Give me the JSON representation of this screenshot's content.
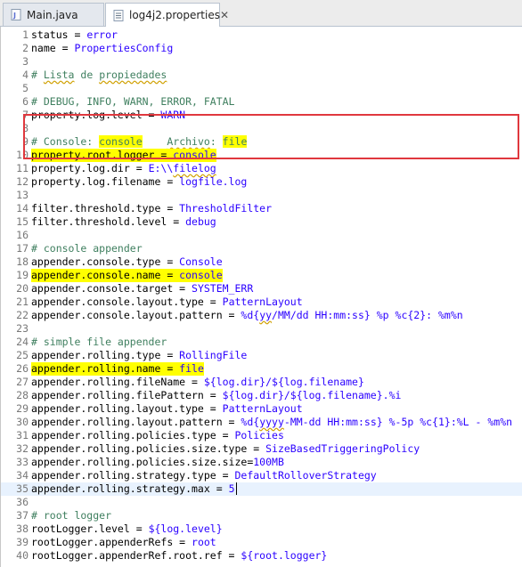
{
  "tabs": [
    {
      "label": "Main.java",
      "icon": "java-file-icon",
      "active": false
    },
    {
      "label": "log4j2.properties",
      "icon": "properties-file-icon",
      "active": true,
      "close": "✕"
    }
  ],
  "colors": {
    "key": "#000000",
    "value": "#2a00ff",
    "comment": "#3f7f5f",
    "highlight": "#ffff00",
    "current_line": "#e8f2fe",
    "annotation_box": "#e0383e"
  },
  "lines": [
    {
      "n": "1",
      "hl": false,
      "segs": [
        [
          "k",
          "status = "
        ],
        [
          "v",
          "error"
        ]
      ]
    },
    {
      "n": "2",
      "hl": false,
      "segs": [
        [
          "k",
          "name = "
        ],
        [
          "v",
          "PropertiesConfig"
        ]
      ]
    },
    {
      "n": "3",
      "hl": false,
      "segs": []
    },
    {
      "n": "4",
      "hl": false,
      "segs": [
        [
          "c",
          "# "
        ],
        [
          "cu",
          "Lista"
        ],
        [
          "c",
          " de "
        ],
        [
          "cu",
          "propiedades"
        ]
      ]
    },
    {
      "n": "5",
      "hl": false,
      "segs": []
    },
    {
      "n": "6",
      "hl": false,
      "segs": [
        [
          "c",
          "# DEBUG, INFO, WARN, ERROR, FATAL"
        ]
      ]
    },
    {
      "n": "7",
      "hl": false,
      "segs": [
        [
          "k",
          "property.log.level = "
        ],
        [
          "v",
          "WARN"
        ]
      ]
    },
    {
      "n": "8",
      "hl": false,
      "segs": []
    },
    {
      "n": "9",
      "hl": false,
      "segs": [
        [
          "c",
          "# Console: "
        ],
        [
          "ch",
          "console"
        ],
        [
          "c",
          "    "
        ],
        [
          "cu",
          "Archivo"
        ],
        [
          "c",
          ": "
        ],
        [
          "ch",
          "file"
        ]
      ]
    },
    {
      "n": "10",
      "hl": true,
      "segs": [
        [
          "k",
          "property.root.logger = "
        ],
        [
          "v",
          "console"
        ]
      ]
    },
    {
      "n": "11",
      "hl": false,
      "segs": [
        [
          "k",
          "property.log.dir = "
        ],
        [
          "v",
          "E:\\\\"
        ],
        [
          "vu",
          "filelog"
        ]
      ]
    },
    {
      "n": "12",
      "hl": false,
      "segs": [
        [
          "k",
          "property.log.filename = "
        ],
        [
          "v",
          "logfile.log"
        ]
      ]
    },
    {
      "n": "13",
      "hl": false,
      "segs": []
    },
    {
      "n": "14",
      "hl": false,
      "segs": [
        [
          "k",
          "filter.threshold.type = "
        ],
        [
          "v",
          "ThresholdFilter"
        ]
      ]
    },
    {
      "n": "15",
      "hl": false,
      "segs": [
        [
          "k",
          "filter.threshold.level = "
        ],
        [
          "v",
          "debug"
        ]
      ]
    },
    {
      "n": "16",
      "hl": false,
      "segs": []
    },
    {
      "n": "17",
      "hl": false,
      "segs": [
        [
          "c",
          "# console appender"
        ]
      ]
    },
    {
      "n": "18",
      "hl": false,
      "segs": [
        [
          "k",
          "appender.console.type = "
        ],
        [
          "v",
          "Console"
        ]
      ]
    },
    {
      "n": "19",
      "hl": true,
      "segs": [
        [
          "k",
          "appender.console.name = "
        ],
        [
          "v",
          "console"
        ]
      ]
    },
    {
      "n": "20",
      "hl": false,
      "segs": [
        [
          "k",
          "appender.console.target = "
        ],
        [
          "v",
          "SYSTEM_ERR"
        ]
      ]
    },
    {
      "n": "21",
      "hl": false,
      "segs": [
        [
          "k",
          "appender.console.layout.type = "
        ],
        [
          "v",
          "PatternLayout"
        ]
      ]
    },
    {
      "n": "22",
      "hl": false,
      "segs": [
        [
          "k",
          "appender.console.layout.pattern = "
        ],
        [
          "v",
          "%d{"
        ],
        [
          "vu",
          "yy"
        ],
        [
          "v",
          "/MM/dd HH:mm:ss} %p %c{2}: %m%n"
        ]
      ]
    },
    {
      "n": "23",
      "hl": false,
      "segs": []
    },
    {
      "n": "24",
      "hl": false,
      "segs": [
        [
          "c",
          "# simple file appender"
        ]
      ]
    },
    {
      "n": "25",
      "hl": false,
      "segs": [
        [
          "k",
          "appender.rolling.type = "
        ],
        [
          "v",
          "RollingFile"
        ]
      ]
    },
    {
      "n": "26",
      "hl": true,
      "segs": [
        [
          "k",
          "appender.rolling.name = "
        ],
        [
          "v",
          "file"
        ]
      ]
    },
    {
      "n": "27",
      "hl": false,
      "segs": [
        [
          "k",
          "appender.rolling.fileName = "
        ],
        [
          "v",
          "${log.dir}/${log.filename}"
        ]
      ]
    },
    {
      "n": "28",
      "hl": false,
      "segs": [
        [
          "k",
          "appender.rolling.filePattern = "
        ],
        [
          "v",
          "${log.dir}/${log.filename}.%i"
        ]
      ]
    },
    {
      "n": "29",
      "hl": false,
      "segs": [
        [
          "k",
          "appender.rolling.layout.type = "
        ],
        [
          "v",
          "PatternLayout"
        ]
      ]
    },
    {
      "n": "30",
      "hl": false,
      "segs": [
        [
          "k",
          "appender.rolling.layout.pattern = "
        ],
        [
          "v",
          "%d{"
        ],
        [
          "vu",
          "yyyy"
        ],
        [
          "v",
          "-MM-dd HH:mm:ss} %-5p %c{1}:%L - %m%n"
        ]
      ]
    },
    {
      "n": "31",
      "hl": false,
      "segs": [
        [
          "k",
          "appender.rolling.policies.type = "
        ],
        [
          "v",
          "Policies"
        ]
      ]
    },
    {
      "n": "32",
      "hl": false,
      "segs": [
        [
          "k",
          "appender.rolling.policies.size.type = "
        ],
        [
          "v",
          "SizeBasedTriggeringPolicy"
        ]
      ]
    },
    {
      "n": "33",
      "hl": false,
      "segs": [
        [
          "k",
          "appender.rolling.policies.size.size="
        ],
        [
          "v",
          "100MB"
        ]
      ]
    },
    {
      "n": "34",
      "hl": false,
      "segs": [
        [
          "k",
          "appender.rolling.strategy.type = "
        ],
        [
          "v",
          "DefaultRolloverStrategy"
        ]
      ]
    },
    {
      "n": "35",
      "hl": false,
      "current": true,
      "segs": [
        [
          "k",
          "appender.rolling.strategy.max = "
        ],
        [
          "v",
          "5"
        ]
      ]
    },
    {
      "n": "36",
      "hl": false,
      "segs": []
    },
    {
      "n": "37",
      "hl": false,
      "segs": [
        [
          "c",
          "# root logger"
        ]
      ]
    },
    {
      "n": "38",
      "hl": false,
      "segs": [
        [
          "k",
          "rootLogger.level = "
        ],
        [
          "v",
          "${log.level}"
        ]
      ]
    },
    {
      "n": "39",
      "hl": false,
      "segs": [
        [
          "k",
          "rootLogger.appenderRefs = "
        ],
        [
          "v",
          "root"
        ]
      ]
    },
    {
      "n": "40",
      "hl": false,
      "segs": [
        [
          "k",
          "rootLogger.appenderRef.root.ref = "
        ],
        [
          "v",
          "${root.logger}"
        ]
      ]
    }
  ]
}
